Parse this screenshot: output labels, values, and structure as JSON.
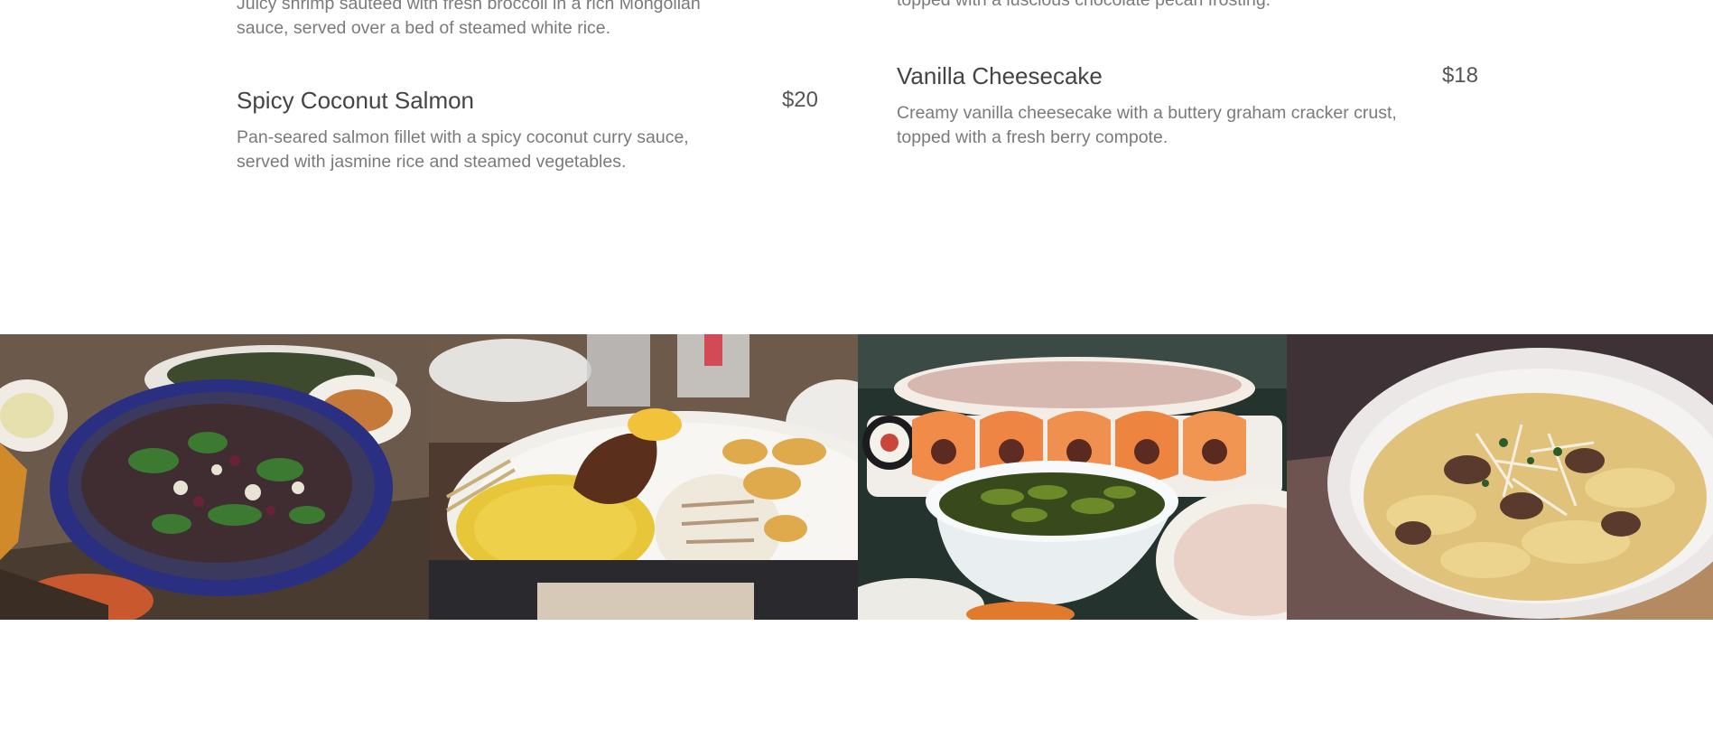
{
  "menu": {
    "left_column": {
      "partial_desc": "Juicy shrimp sautéed with fresh broccoli in a rich Mongolian sauce, served over a bed of steamed white rice.",
      "items": [
        {
          "title": "Spicy Coconut Salmon",
          "price": "$20",
          "description": "Pan-seared salmon fillet with a spicy coconut curry sauce, served with jasmine rice and steamed vegetables."
        }
      ]
    },
    "right_column": {
      "partial_desc": "topped with a luscious chocolate pecan frosting.",
      "items": [
        {
          "title": "Vanilla Cheesecake",
          "price": "$18",
          "description": "Creamy vanilla cheesecake with a buttery graham cracker crust, topped with a fresh berry compote."
        }
      ]
    }
  },
  "gallery": {
    "photos": [
      {
        "subject": "salad bowl with greens, beets and cheese"
      },
      {
        "subject": "grilled squid with saffron rice and potatoes"
      },
      {
        "subject": "salmon sushi rolls with edamame bowl"
      },
      {
        "subject": "pasta with beef and shaved parmesan"
      }
    ]
  }
}
